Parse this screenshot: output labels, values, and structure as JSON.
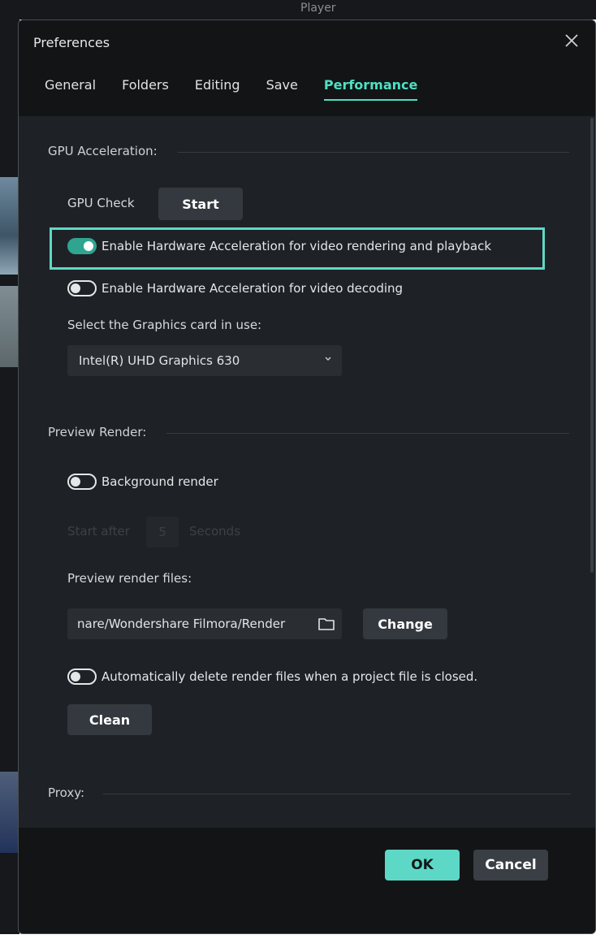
{
  "background": {
    "player_label": "Player"
  },
  "dialog": {
    "title": "Preferences"
  },
  "tabs": [
    {
      "label": "General"
    },
    {
      "label": "Folders"
    },
    {
      "label": "Editing"
    },
    {
      "label": "Save"
    },
    {
      "label": "Performance",
      "active": true
    }
  ],
  "gpu": {
    "section_title": "GPU Acceleration:",
    "check_label": "GPU Check",
    "start_button": "Start",
    "hw_render_label": "Enable Hardware Acceleration for video rendering and playback",
    "hw_render_enabled": true,
    "hw_decode_label": "Enable Hardware Acceleration for video decoding",
    "hw_decode_enabled": false,
    "graphics_card_label": "Select the Graphics card in use:",
    "graphics_card_value": "Intel(R) UHD Graphics 630"
  },
  "preview_render": {
    "section_title": "Preview Render:",
    "background_render_label": "Background render",
    "background_render_enabled": false,
    "start_after_label": "Start after",
    "start_after_value": "5",
    "seconds_label": "Seconds",
    "files_label": "Preview render files:",
    "path_value": "nare/Wondershare Filmora/Render",
    "change_button": "Change",
    "auto_delete_label": "Automatically delete render files when a project file is closed.",
    "auto_delete_enabled": false,
    "clean_button": "Clean"
  },
  "proxy": {
    "section_title": "Proxy:"
  },
  "footer": {
    "ok_label": "OK",
    "cancel_label": "Cancel"
  },
  "colors": {
    "accent": "#4fe0c3",
    "highlight": "#5ed8c6",
    "toggle_on": "#2fa58f",
    "dialog_bg": "#1e2226",
    "header_bg": "#121416"
  }
}
